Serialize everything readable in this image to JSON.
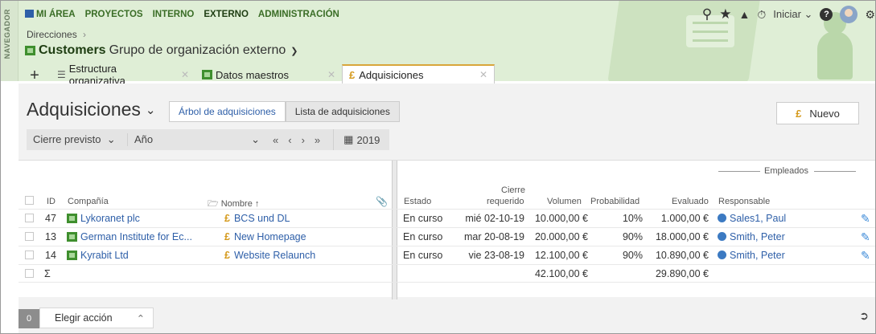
{
  "nav_rail": {
    "label": "NAVEGADOR"
  },
  "topnav": {
    "items": [
      {
        "label": "MI ÁREA"
      },
      {
        "label": "PROYECTOS"
      },
      {
        "label": "INTERNO"
      },
      {
        "label": "EXTERNO"
      },
      {
        "label": "ADMINISTRACIÓN"
      }
    ],
    "active": "EXTERNO"
  },
  "breadcrumb": {
    "label": "Direcciones",
    "sep": "›"
  },
  "context": {
    "name": "Customers",
    "type": "Grupo de organización externo"
  },
  "header_tools": {
    "start_label": "Iniciar"
  },
  "tabs": [
    {
      "label": "Estructura organizativa"
    },
    {
      "label": "Datos maestros"
    },
    {
      "label": "Adquisiciones"
    }
  ],
  "page": {
    "title": "Adquisiciones",
    "views": [
      "Árbol de adquisiciones",
      "Lista de adquisiciones"
    ],
    "new_button": "Nuevo"
  },
  "filter": {
    "field": "Cierre previsto",
    "period": "Año",
    "year": "2019",
    "nav": [
      "«",
      "‹",
      "›",
      "»"
    ]
  },
  "table": {
    "columns": {
      "id": "ID",
      "company": "Compañía",
      "name": "Nombre",
      "state": "Estado",
      "close_a": "Cierre",
      "close_b": "requerido",
      "volume": "Volumen",
      "probability": "Probabilidad",
      "evaluated": "Evaluado",
      "group": "Empleados",
      "responsible": "Responsable"
    },
    "rows": [
      {
        "id": "47",
        "company": "Lykoranet plc",
        "name": "BCS und DL",
        "state": "En curso",
        "close": "mié 02-10-19",
        "volume": "10.000,00 €",
        "probability": "10%",
        "evaluated": "1.000,00 €",
        "responsible": "Sales1, Paul"
      },
      {
        "id": "13",
        "company": "German Institute for Ec...",
        "name": "New Homepage",
        "state": "En curso",
        "close": "mar 20-08-19",
        "volume": "20.000,00 €",
        "probability": "90%",
        "evaluated": "18.000,00 €",
        "responsible": "Smith, Peter"
      },
      {
        "id": "14",
        "company": "Kyrabit Ltd",
        "name": "Website Relaunch",
        "state": "En curso",
        "close": "vie 23-08-19",
        "volume": "12.100,00 €",
        "probability": "90%",
        "evaluated": "10.890,00 €",
        "responsible": "Smith, Peter"
      }
    ],
    "totals": {
      "symbol": "Σ",
      "volume": "42.100,00 €",
      "evaluated": "29.890,00 €"
    }
  },
  "bottom": {
    "count": "0",
    "action_label": "Elegir acción"
  }
}
